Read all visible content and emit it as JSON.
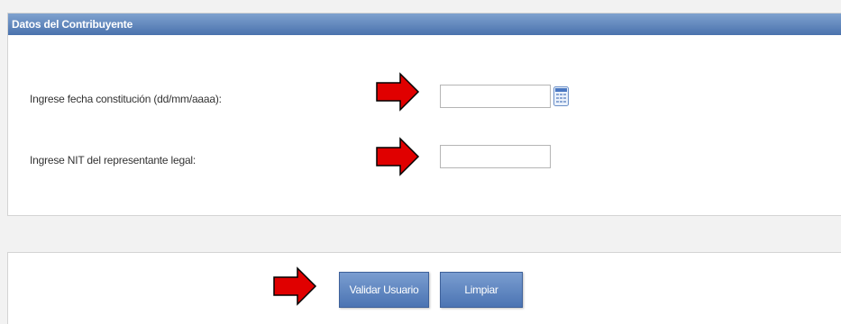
{
  "panel": {
    "title": "Datos del Contribuyente"
  },
  "form": {
    "fecha_label": "Ingrese fecha constitución (dd/mm/aaaa):",
    "fecha_value": "",
    "nit_label": "Ingrese NIT del representante legal:",
    "nit_value": ""
  },
  "actions": {
    "validar_label": "Validar Usuario",
    "limpiar_label": "Limpiar"
  },
  "icons": {
    "calendar": "calendar-icon",
    "pointer": "red-arrow-icon"
  },
  "colors": {
    "header": "#4a72ad",
    "button": "#5b82bf",
    "arrow": "#e00000"
  }
}
